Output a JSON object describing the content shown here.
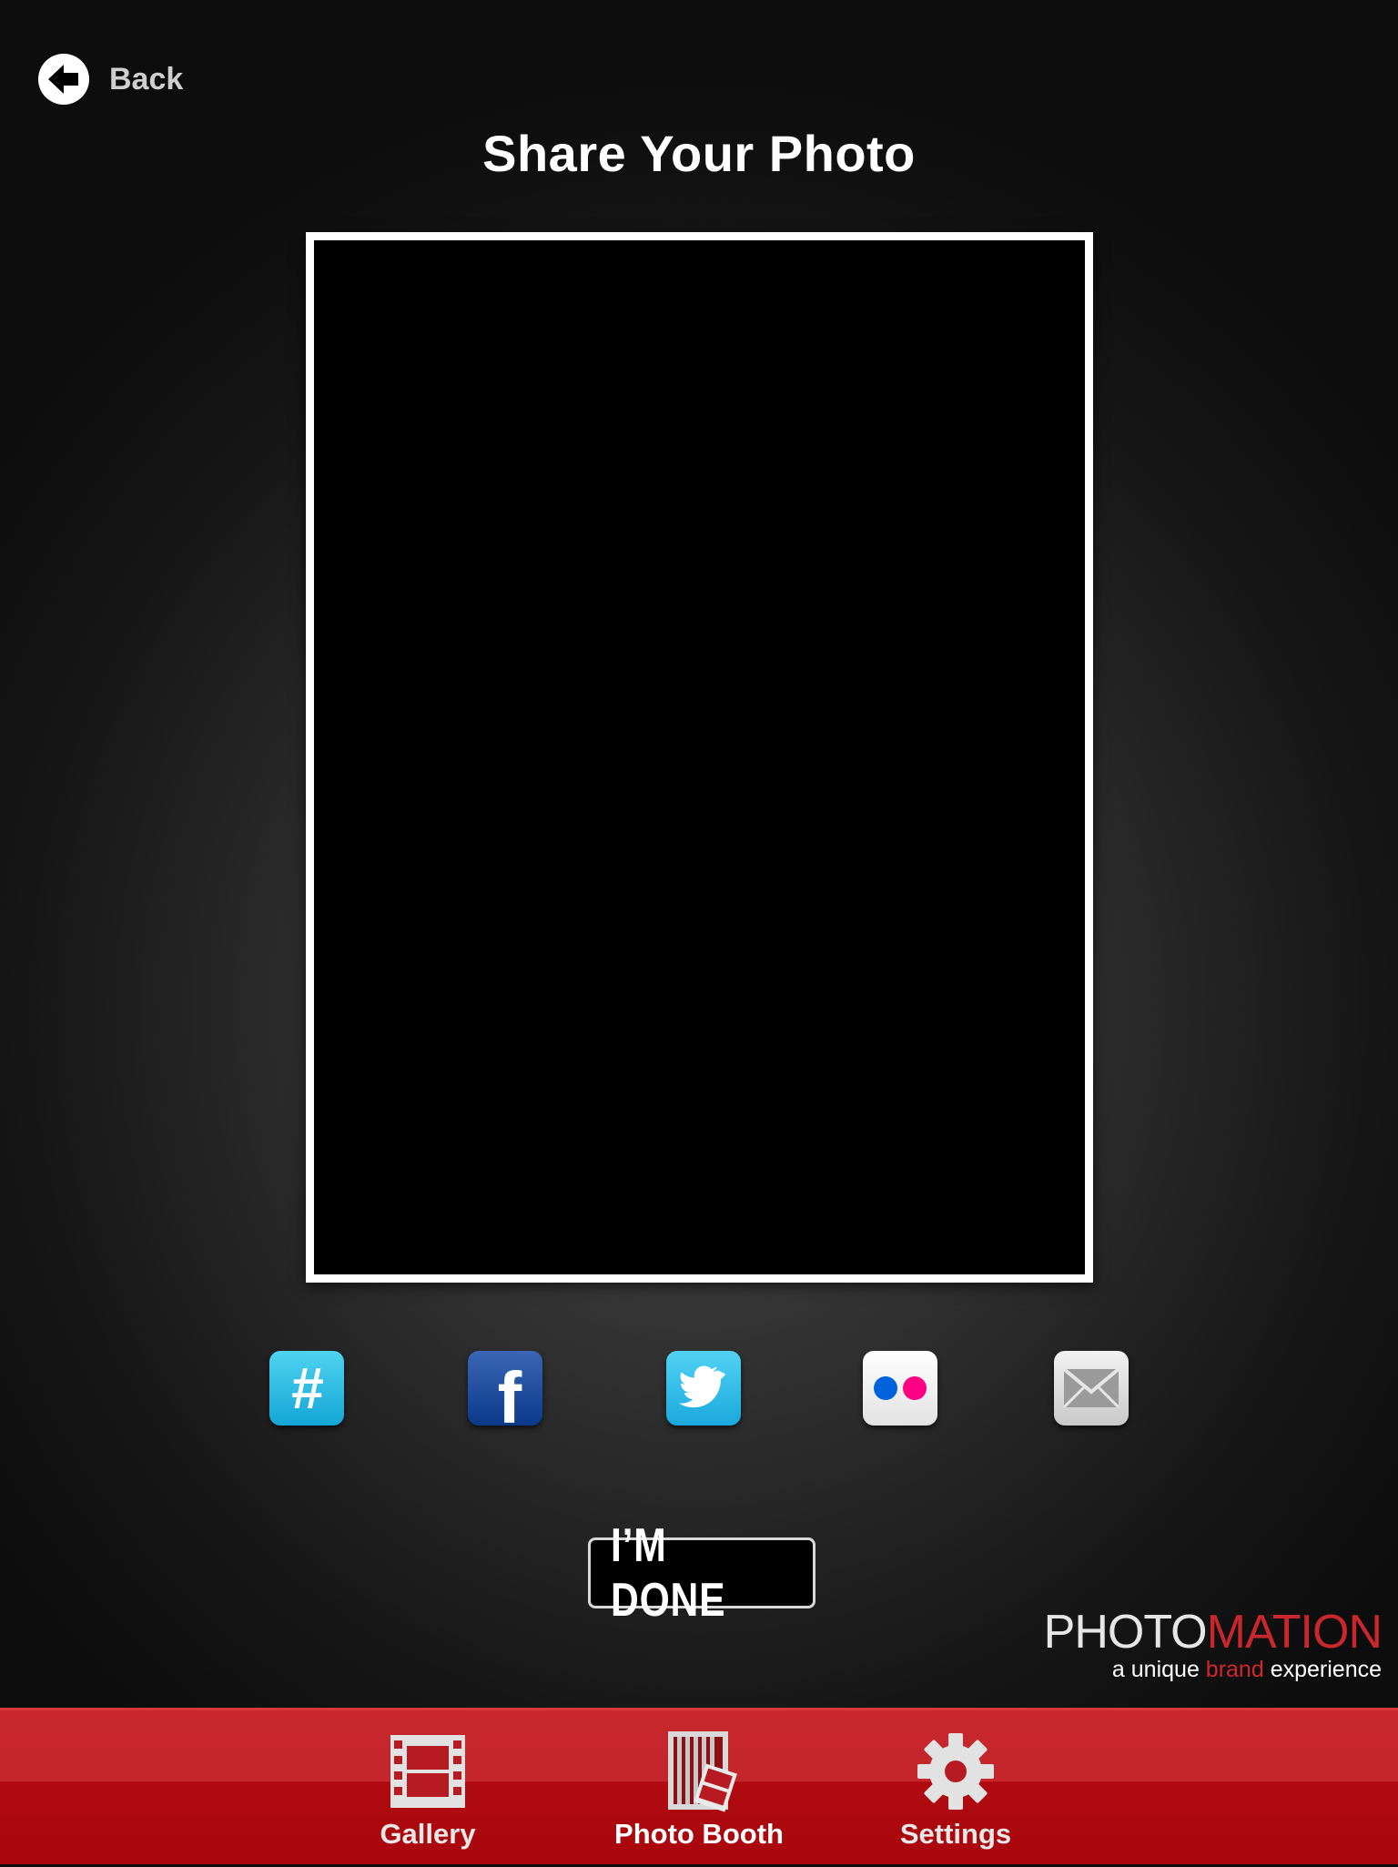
{
  "nav": {
    "back_label": "Back"
  },
  "page": {
    "title": "Share Your Photo"
  },
  "share": {
    "icons": [
      "hashtag-icon",
      "facebook-icon",
      "twitter-icon",
      "flickr-icon",
      "email-icon"
    ],
    "hashtag_glyph": "#",
    "facebook_glyph": "f"
  },
  "done": {
    "label": "I’M DONE"
  },
  "logo": {
    "word_part1": "PHOTO",
    "word_part2": "MATION",
    "tagline_pre": "a unique ",
    "tagline_highlight": "brand",
    "tagline_post": " experience"
  },
  "tabbar": {
    "tabs": [
      {
        "label": "Gallery",
        "icon": "film-strip-icon"
      },
      {
        "label": "Photo Booth",
        "icon": "photo-booth-icon",
        "selected": true
      },
      {
        "label": "Settings",
        "icon": "gear-icon"
      }
    ]
  },
  "colors": {
    "accent_red": "#c4262c",
    "tabbar_dark_red": "#a8080d",
    "logo_red": "#c8282d"
  }
}
